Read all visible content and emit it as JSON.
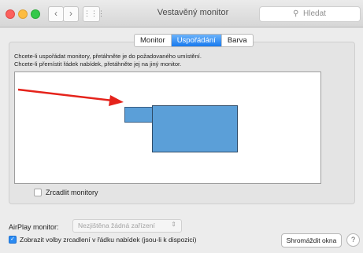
{
  "window": {
    "title": "Vestavěný monitor",
    "search_placeholder": "Hledat",
    "nav_back": "‹",
    "nav_forward": "›",
    "grid_icon": "⋮⋮⋮"
  },
  "tabs": [
    {
      "label": "Monitor",
      "active": false
    },
    {
      "label": "Uspořádání",
      "active": true
    },
    {
      "label": "Barva",
      "active": false
    }
  ],
  "arrangement": {
    "instruction_line1": "Chcete-li uspořádat monitory, přetáhněte je do požadovaného umístění.",
    "instruction_line2": "Chcete-li přemístit řádek nabídek, přetáhněte jej na jiný monitor.",
    "mirror_label": "Zrcadlit monitory",
    "mirror_checked": false
  },
  "airplay": {
    "label": "AirPlay monitor:",
    "value": "Nezjištěna žádná zařízení"
  },
  "show_mirroring": {
    "label": "Zobrazit volby zrcadlení v řádku nabídek (jsou-li k dispozici)",
    "checked": true
  },
  "buttons": {
    "gather_windows": "Shromáždit okna",
    "help": "?"
  },
  "colors": {
    "accent": "#1779ee",
    "monitor_fill": "#5b9fd8",
    "annotation_arrow": "#e5231b"
  }
}
